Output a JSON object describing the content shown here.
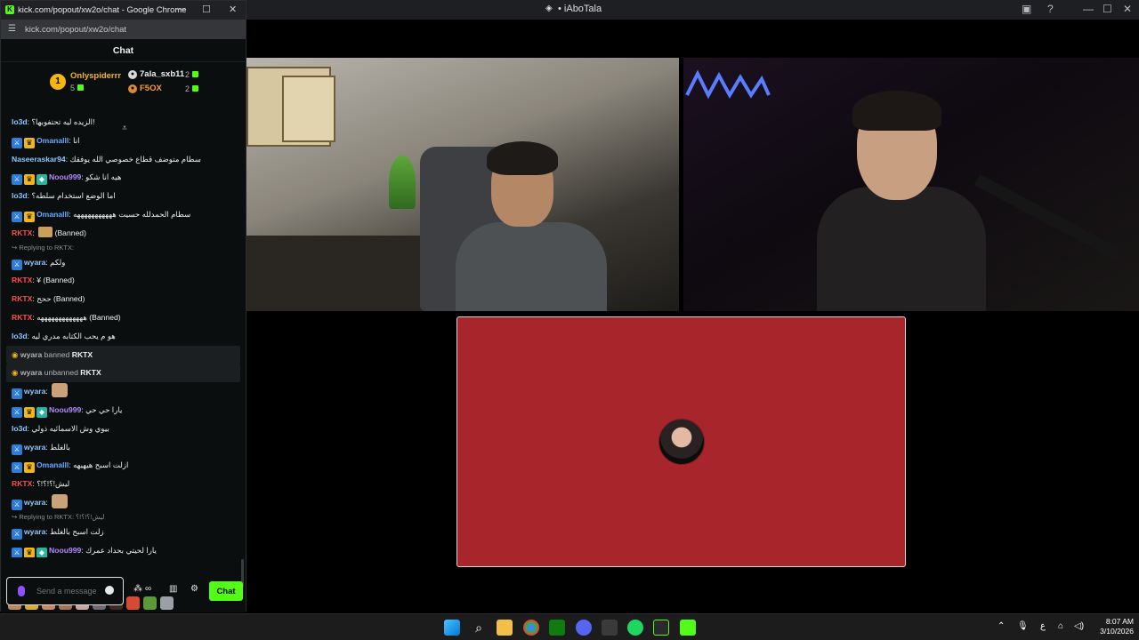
{
  "chrome": {
    "window_title": "kick.com/popout/xw2o/chat - Google Chrome",
    "url": "kick.com/popout/xw2o/chat"
  },
  "discord": {
    "title": "• iAboTala"
  },
  "chat": {
    "header": "Chat",
    "leaderboard": [
      {
        "name": "Onlyspiderrr",
        "count": "5",
        "rank": "1",
        "color": "#f6b70f"
      },
      {
        "name": "7ala_sxb11",
        "count": "2",
        "color": "#ffffff"
      },
      {
        "name": "F5OX",
        "count": "2",
        "color": "#ff9a3c"
      }
    ],
    "input_placeholder": "Send a message",
    "send_label": "Chat",
    "tool_infinity": "∞",
    "messages": [
      {
        "type": "msg",
        "user": "lo3d",
        "color": "u-light",
        "text": "الزيده ليه تحتفوبها؟!"
      },
      {
        "type": "msg",
        "user": "Omanalll",
        "color": "u-blue",
        "badges": [
          "mod",
          "vip"
        ],
        "text": "انا"
      },
      {
        "type": "msg",
        "user": "Naseeraskar94",
        "color": "u-light",
        "text": "سطام متوضف قطاع خصوصي الله يوفقك"
      },
      {
        "type": "msg",
        "user": "Noou999",
        "color": "u-purple",
        "badges": [
          "mod",
          "vip",
          "sub"
        ],
        "text": "هيه انا شكو"
      },
      {
        "type": "msg",
        "user": "lo3d",
        "color": "u-light",
        "text": "اما الوضع استخدام سلطه؟"
      },
      {
        "type": "msg",
        "user": "Omanalll",
        "color": "u-blue",
        "badges": [
          "mod",
          "vip"
        ],
        "text": "سطام الحمدلله حسيت هههههههههههه"
      },
      {
        "type": "msg",
        "user": "RKTX",
        "color": "u-red",
        "emote": true,
        "text": "(Banned)"
      },
      {
        "type": "reply",
        "text": "Replying to RKTX:"
      },
      {
        "type": "msg",
        "user": "wyara",
        "color": "u-light",
        "badges": [
          "mod"
        ],
        "text": "ولكم"
      },
      {
        "type": "msg",
        "user": "RKTX",
        "color": "u-red",
        "text": "¥ (Banned)"
      },
      {
        "type": "msg",
        "user": "RKTX",
        "color": "u-red",
        "text": "ححح (Banned)"
      },
      {
        "type": "msg",
        "user": "RKTX",
        "color": "u-red",
        "text": "هههههههههههههه (Banned)"
      },
      {
        "type": "msg",
        "user": "lo3d",
        "color": "u-light",
        "text": "هو م يحب الكتابه مدري ليه"
      },
      {
        "type": "sys",
        "actor": "wyara",
        "action": "banned",
        "target": "RKTX"
      },
      {
        "type": "sys",
        "actor": "wyara",
        "action": "unbanned",
        "target": "RKTX"
      },
      {
        "type": "msg",
        "user": "wyara",
        "color": "u-light",
        "badges": [
          "mod"
        ],
        "emote_big": true,
        "text": ""
      },
      {
        "type": "msg",
        "user": "Noou999",
        "color": "u-purple",
        "badges": [
          "mod",
          "vip",
          "sub"
        ],
        "text": "يارا حي حي"
      },
      {
        "type": "msg",
        "user": "lo3d",
        "color": "u-light",
        "text": "بيوي وش الاسمائيه ذولي"
      },
      {
        "type": "msg",
        "user": "wyara",
        "color": "u-light",
        "badges": [
          "mod"
        ],
        "text": "بالغلط"
      },
      {
        "type": "msg",
        "user": "Omanalll",
        "color": "u-blue",
        "badges": [
          "mod",
          "vip"
        ],
        "text": "ازلت اسبح هيهيهه"
      },
      {
        "type": "msg",
        "user": "RKTX",
        "color": "u-red",
        "text": "ليش!؟!؟!؟"
      },
      {
        "type": "msg",
        "user": "wyara",
        "color": "u-light",
        "badges": [
          "mod"
        ],
        "emote_big": true,
        "text": ""
      },
      {
        "type": "reply",
        "text": "Replying to RKTX: ليش!؟!؟!؟"
      },
      {
        "type": "msg",
        "user": "wyara",
        "color": "u-light",
        "badges": [
          "mod"
        ],
        "text": "زلت اسبح بالغلط"
      },
      {
        "type": "msg",
        "user": "Noou999",
        "color": "u-purple",
        "badges": [
          "mod",
          "vip",
          "sub"
        ],
        "text": "يارا لحيتي بحداد عمرك"
      }
    ]
  },
  "taskbar": {
    "time": "8:07 AM",
    "date": "3/10/2026",
    "lang": "ع"
  },
  "colors": {
    "kick_green": "#53fc18",
    "red_tile": "#a8262b"
  }
}
